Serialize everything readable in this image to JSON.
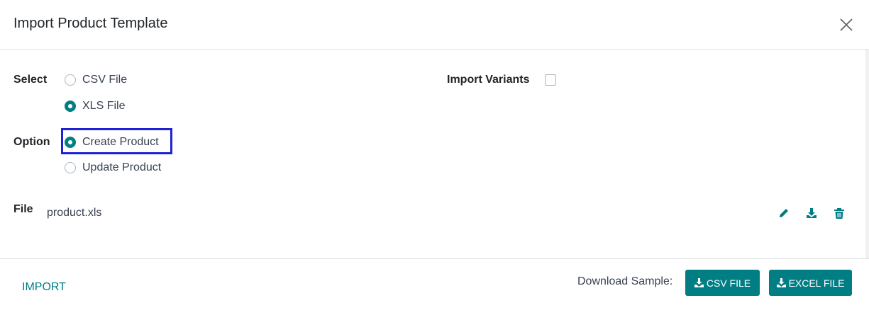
{
  "dialog": {
    "title": "Import Product Template"
  },
  "select": {
    "label": "Select",
    "options": [
      {
        "label": "CSV File",
        "checked": false
      },
      {
        "label": "XLS File",
        "checked": true
      }
    ]
  },
  "import_variants": {
    "label": "Import Variants",
    "checked": false
  },
  "option": {
    "label": "Option",
    "options": [
      {
        "label": "Create Product",
        "checked": true
      },
      {
        "label": "Update Product",
        "checked": false
      }
    ]
  },
  "file": {
    "label": "File",
    "value": "product.xls",
    "icons": [
      "pencil-icon",
      "download-icon",
      "trash-icon"
    ]
  },
  "footer": {
    "import_label": "IMPORT",
    "download_label": "Download Sample:",
    "csv_button": "CSV FILE",
    "excel_button": "EXCEL FILE"
  },
  "colors": {
    "accent": "#017e84",
    "highlight": "#1e22d6"
  }
}
